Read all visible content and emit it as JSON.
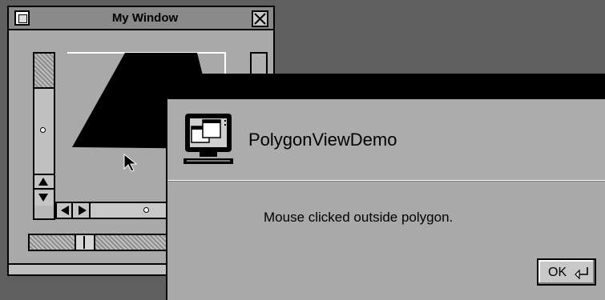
{
  "window": {
    "title": "My Window",
    "close_icon": "close-box-icon",
    "zoom_icon": "zoom-x-icon"
  },
  "dialog": {
    "app_name": "PolygonViewDemo",
    "app_icon": "computer-monitor-icon",
    "message": "Mouse clicked outside polygon.",
    "ok_label": "OK",
    "return_icon": "return-arrow-icon"
  },
  "colors": {
    "desktop": "#5f5f5f",
    "window_bg": "#a9a9a9",
    "polygon_fill": "#000000",
    "dialog_titlebar": "#000000"
  }
}
